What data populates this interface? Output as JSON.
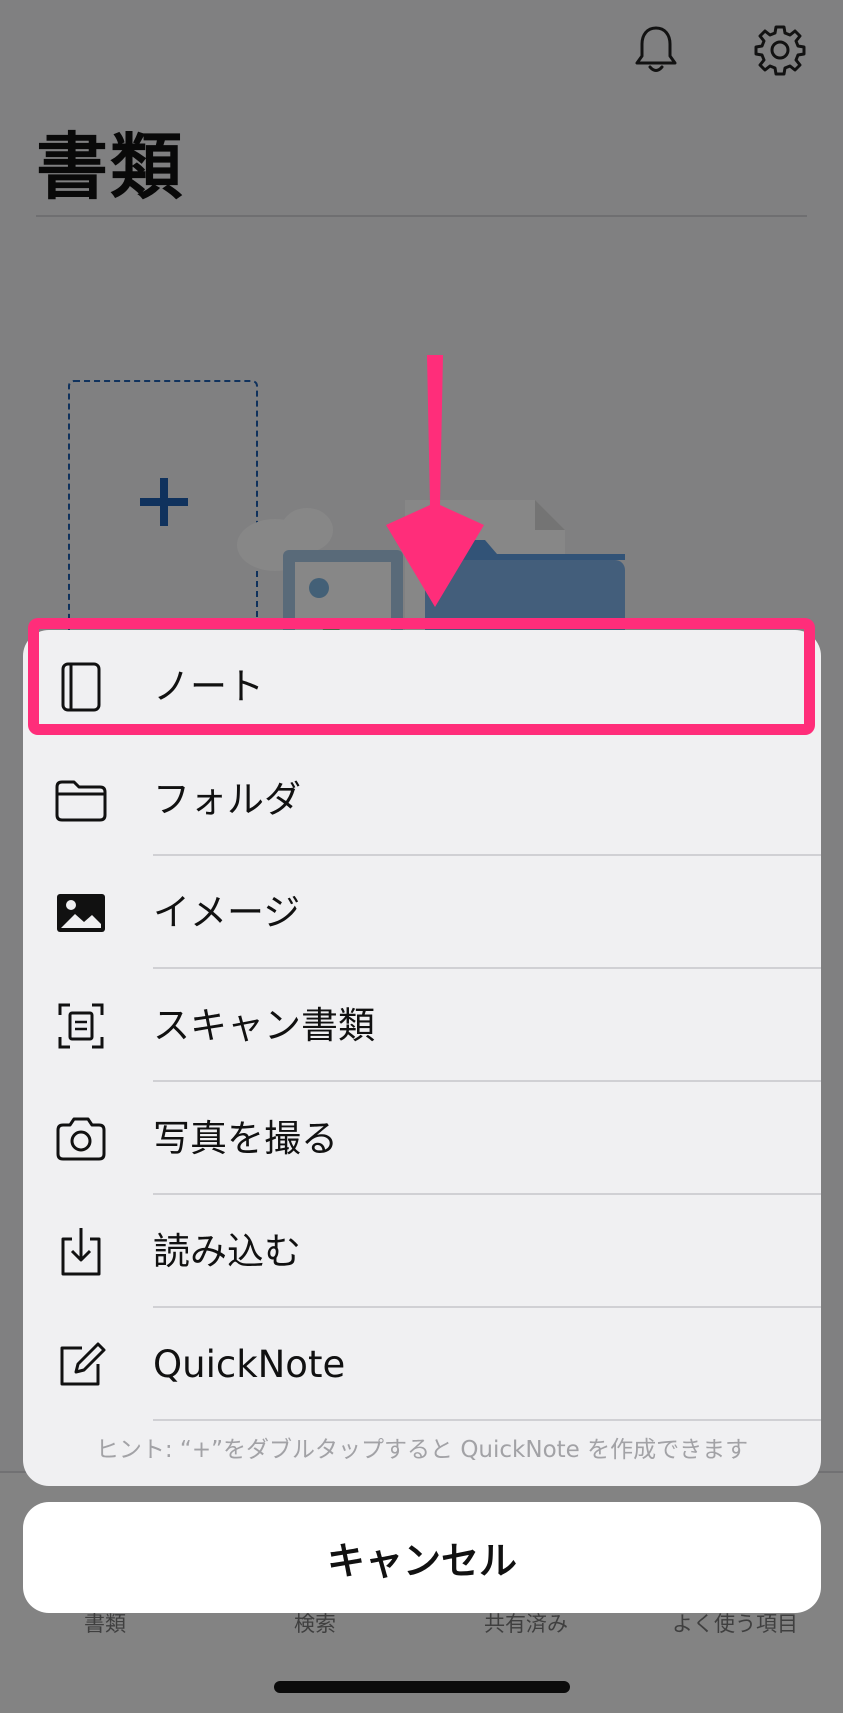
{
  "page": {
    "title": "書類",
    "icons": {
      "notifications": "bell-icon",
      "settings": "gear-icon",
      "new_item": "plus-icon"
    },
    "tabs": [
      "書類",
      "検索",
      "共有済み",
      "よく使う項目"
    ]
  },
  "action_sheet": {
    "items": [
      {
        "label": "ノート",
        "icon": "notebook-icon"
      },
      {
        "label": "フォルダ",
        "icon": "folder-icon"
      },
      {
        "label": "イメージ",
        "icon": "image-icon"
      },
      {
        "label": "スキャン書類",
        "icon": "scan-icon"
      },
      {
        "label": "写真を撮る",
        "icon": "camera-icon"
      },
      {
        "label": "読み込む",
        "icon": "import-icon"
      },
      {
        "label": "QuickNote",
        "icon": "quicknote-icon"
      }
    ],
    "hint": "ヒント: “+”をダブルタップすると QuickNote を作成できます",
    "cancel_label": "キャンセル"
  },
  "annotation": {
    "color": "#ff2d7a"
  },
  "colors": {
    "accent_blue": "#1f5fb0",
    "dim_overlay": "rgba(0,0,0,0.47)"
  }
}
